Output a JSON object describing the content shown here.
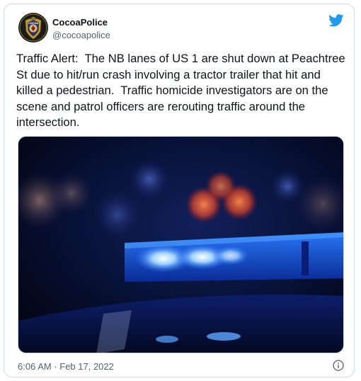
{
  "tweet": {
    "display_name": "CocoaPolice",
    "handle": "@cocoapolice",
    "text": "Traffic Alert:  The NB lanes of US 1 are shut down at Peachtree St due to hit/run crash involving a tractor trailer that hit and killed a pedestrian.  Traffic homicide investigators are on the scene and patrol officers are rerouting traffic around the intersection.",
    "timestamp": "6:06 AM · Feb 17, 2022"
  },
  "avatar": {
    "badge_top_text": "POLICE",
    "badge_city_text": "COCOA"
  },
  "icons": {
    "brand": "twitter-bird-icon",
    "info": "info-icon"
  },
  "colors": {
    "twitter_blue": "#1d9bf0",
    "text_primary": "#0f1419",
    "text_secondary": "#536471",
    "border": "#cfd9de"
  }
}
